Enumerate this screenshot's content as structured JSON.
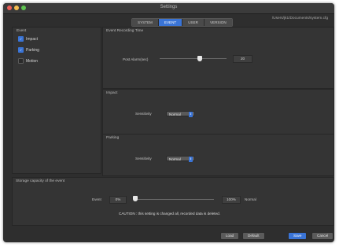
{
  "window": {
    "title": "Settings"
  },
  "tabs": [
    {
      "label": "SYSTEM",
      "active": false
    },
    {
      "label": "EVENT",
      "active": true
    },
    {
      "label": "USER",
      "active": false
    },
    {
      "label": "VERSION",
      "active": false
    }
  ],
  "path": "/Users/jk1/Documents/system.cfg",
  "event_panel": {
    "title": "Event",
    "items": [
      {
        "label": "Impact",
        "checked": true
      },
      {
        "label": "Parking",
        "checked": true
      },
      {
        "label": "Motion",
        "checked": false
      }
    ]
  },
  "recording": {
    "title": "Event Recording Time",
    "label": "Post Alarm(sec)",
    "value": "20",
    "slider_fraction": 0.6
  },
  "impact": {
    "title": "Impact",
    "sens_label": "Sensitivity",
    "value": "Normal"
  },
  "parking": {
    "title": "Parking",
    "sens_label": "Sensitivity",
    "value": "Normal"
  },
  "storage": {
    "title": "Storage capacity of the event",
    "label": "Event",
    "min": "0%",
    "max": "100%",
    "right_label": "Normal",
    "slider_fraction": 0.0,
    "caution": "CAUTION : this setting is changed all, recorded data is deleted."
  },
  "buttons": {
    "load": "Load",
    "default": "Default",
    "save": "Save",
    "cancel": "Cancel"
  },
  "colors": {
    "accent": "#3a74d6",
    "background": "#2e2e2e"
  }
}
